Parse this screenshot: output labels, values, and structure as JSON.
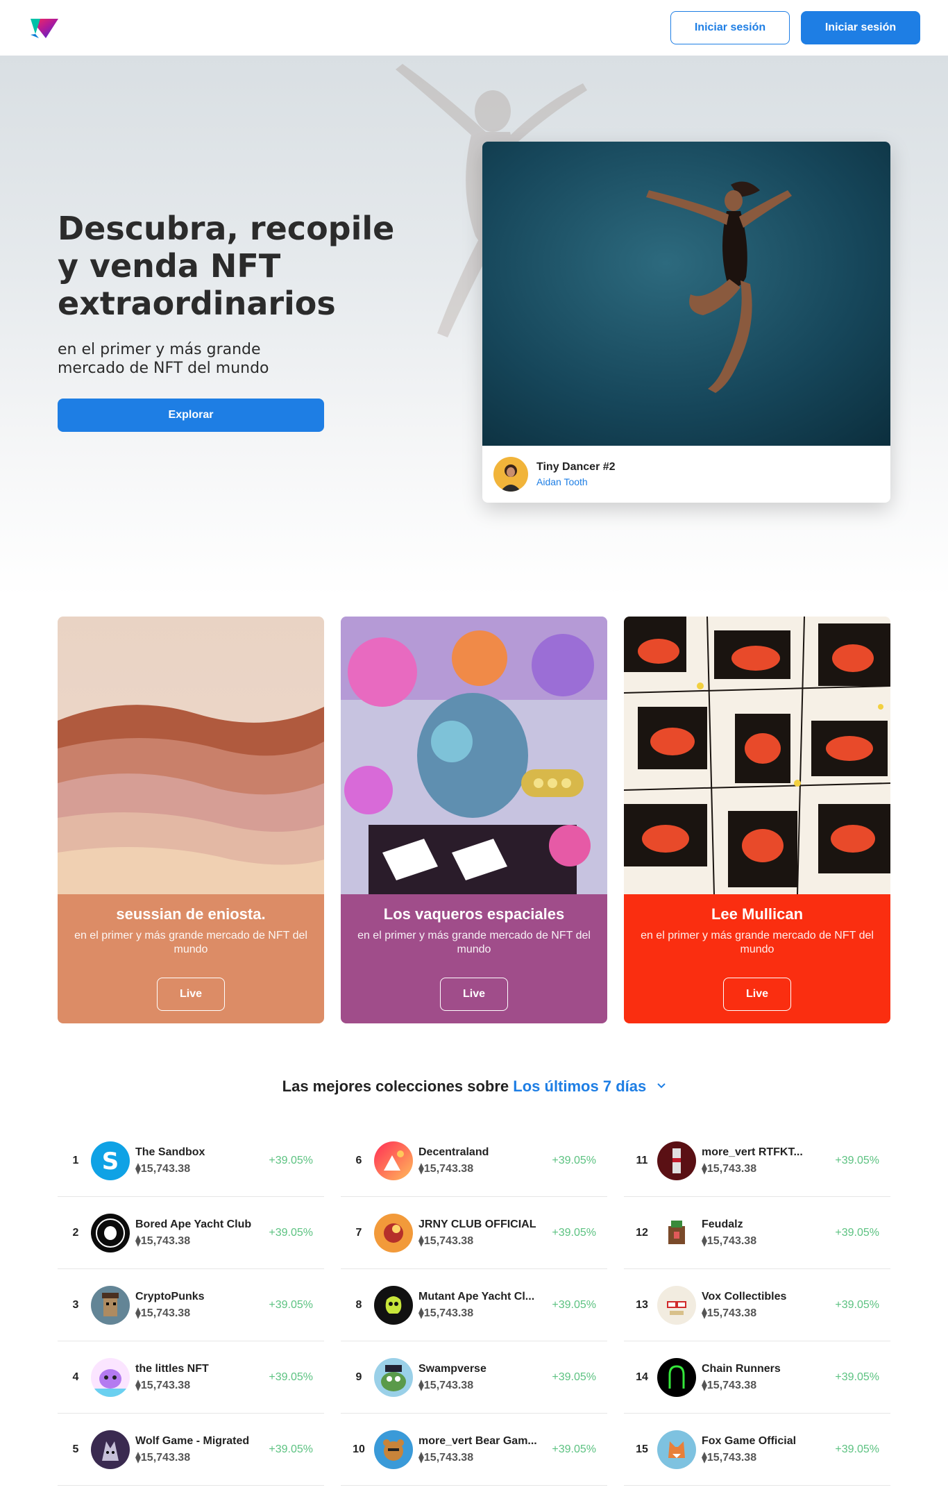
{
  "nav": {
    "login_outline_label": "Iniciar sesión",
    "login_solid_label": "Iniciar sesión"
  },
  "hero": {
    "title": "Descubra, recopile y venda NFT extraordinarios",
    "subtitle": "en el primer y más grande mercado de NFT del mundo",
    "explore_label": "Explorar",
    "featured": {
      "name": "Tiny Dancer #2",
      "author": "Aidan Tooth"
    }
  },
  "drops": [
    {
      "title": "seussian de eniosta.",
      "subtitle": "en el primer y más grande mercado de NFT del mundo",
      "button": "Live",
      "color": "#dc8c66"
    },
    {
      "title": "Los vaqueros espaciales",
      "subtitle": "en el primer y más grande mercado de NFT del mundo",
      "button": "Live",
      "color": "#a04d8a"
    },
    {
      "title": "Lee Mullican",
      "subtitle": "en el primer y más grande mercado de NFT del mundo",
      "button": "Live",
      "color": "#fa2e10"
    }
  ],
  "rankings": {
    "heading": "Las mejores colecciones sobre",
    "period": "Los últimos 7 días",
    "columns": [
      [
        {
          "rank": "1",
          "name": "The Sandbox",
          "price": "⧫15,743.38",
          "change": "+39.05%",
          "avatar_icon": "sandbox-logo-icon"
        },
        {
          "rank": "2",
          "name": "Bored Ape Yacht Club",
          "price": "⧫15,743.38",
          "change": "+39.05%",
          "avatar_icon": "bayc-logo-icon"
        },
        {
          "rank": "3",
          "name": "CryptoPunks",
          "price": "⧫15,743.38",
          "change": "+39.05%",
          "avatar_icon": "cryptopunk-icon"
        },
        {
          "rank": "4",
          "name": "the littles NFT",
          "price": "⧫15,743.38",
          "change": "+39.05%",
          "avatar_icon": "littles-icon"
        },
        {
          "rank": "5",
          "name": "Wolf Game - Migrated",
          "price": "⧫15,743.38",
          "change": "+39.05%",
          "avatar_icon": "wolf-game-icon"
        }
      ],
      [
        {
          "rank": "6",
          "name": "Decentraland",
          "price": "⧫15,743.38",
          "change": "+39.05%",
          "avatar_icon": "decentraland-logo-icon"
        },
        {
          "rank": "7",
          "name": "JRNY CLUB OFFICIAL",
          "price": "⧫15,743.38",
          "change": "+39.05%",
          "avatar_icon": "jrny-club-icon"
        },
        {
          "rank": "8",
          "name": "Mutant Ape Yacht Cl...",
          "price": "⧫15,743.38",
          "change": "+39.05%",
          "avatar_icon": "mayc-logo-icon"
        },
        {
          "rank": "9",
          "name": "Swampverse",
          "price": "⧫15,743.38",
          "change": "+39.05%",
          "avatar_icon": "swampverse-icon"
        },
        {
          "rank": "10",
          "name": "more_vert Bear Gam...",
          "price": "⧫15,743.38",
          "change": "+39.05%",
          "avatar_icon": "bear-games-icon"
        }
      ],
      [
        {
          "rank": "11",
          "name": "more_vert RTFKT...",
          "price": "⧫15,743.38",
          "change": "+39.05%",
          "avatar_icon": "rtfkt-icon"
        },
        {
          "rank": "12",
          "name": "Feudalz",
          "price": "⧫15,743.38",
          "change": "+39.05%",
          "avatar_icon": "feudalz-icon"
        },
        {
          "rank": "13",
          "name": "Vox Collectibles",
          "price": "⧫15,743.38",
          "change": "+39.05%",
          "avatar_icon": "vox-icon"
        },
        {
          "rank": "14",
          "name": "Chain Runners",
          "price": "⧫15,743.38",
          "change": "+39.05%",
          "avatar_icon": "chain-runners-icon"
        },
        {
          "rank": "15",
          "name": "Fox Game Official",
          "price": "⧫15,743.38",
          "change": "+39.05%",
          "avatar_icon": "fox-game-icon"
        }
      ]
    ]
  }
}
